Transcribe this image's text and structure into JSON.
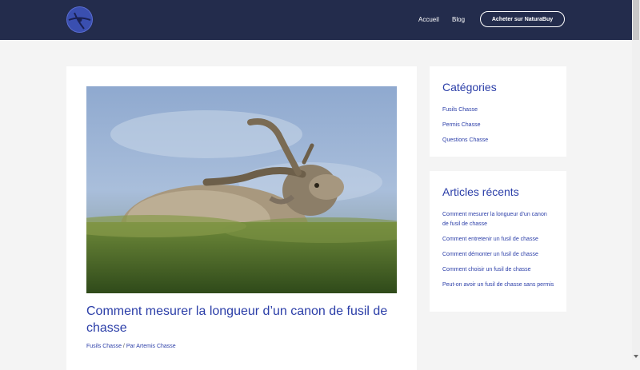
{
  "header": {
    "nav": {
      "home": "Accueil",
      "blog": "Blog"
    },
    "cta_label": "Acheter sur NaturaBuy",
    "bg_color": "#232c4c"
  },
  "post": {
    "title": "Comment mesurer la longueur d’un canon de fusil de chasse",
    "category": "Fusils Chasse",
    "separator": " / ",
    "by_label": "Par",
    "author": "Artemis Chasse"
  },
  "sidebar": {
    "categories": {
      "title": "Catégories",
      "items": [
        "Fusils Chasse",
        "Permis Chasse",
        "Questions Chasse"
      ]
    },
    "recent": {
      "title": "Articles récents",
      "items": [
        "Comment mesurer la longueur d’un canon de fusil de chasse",
        "Comment entretenir un fusil de chasse",
        "Comment démonter un fusil de chasse",
        "Comment choisir un fusil de chasse",
        "Peut-on avoir un fusil de chasse sans permis"
      ]
    }
  },
  "colors": {
    "accent": "#2b3ea8",
    "page_bg": "#f4f4f4"
  }
}
